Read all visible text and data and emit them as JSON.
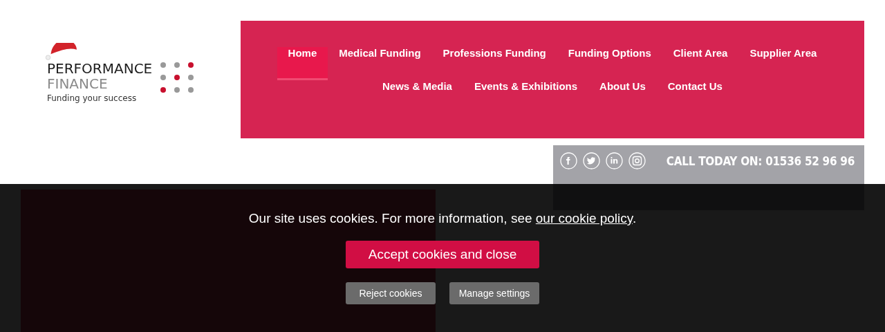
{
  "logo": {
    "line1": "PERFORMANCE",
    "line2": "FINANCE",
    "tagline": "Funding your success"
  },
  "nav": {
    "items": [
      {
        "label": "Home",
        "selected": true
      },
      {
        "label": "Medical Funding",
        "selected": false
      },
      {
        "label": "Professions Funding",
        "selected": false
      },
      {
        "label": "Funding Options",
        "selected": false
      },
      {
        "label": "Client Area",
        "selected": false
      },
      {
        "label": "Supplier Area",
        "selected": false
      },
      {
        "label": "News & Media",
        "selected": false
      },
      {
        "label": "Events & Exhibitions",
        "selected": false
      },
      {
        "label": "About Us",
        "selected": false
      },
      {
        "label": "Contact Us",
        "selected": false
      }
    ]
  },
  "contact": {
    "social": [
      {
        "kind": "facebook"
      },
      {
        "kind": "twitter"
      },
      {
        "kind": "linkedin"
      },
      {
        "kind": "instagram"
      }
    ],
    "call_label": "CALL TODAY ON:",
    "phone": "01536 52 96 96"
  },
  "cookie_banner": {
    "message": "Our site uses cookies. For more information, see ",
    "link": "our cookie policy",
    "message_end": ".",
    "accept": "Accept cookies and close",
    "reject": "Reject cookies",
    "manage": "Manage settings"
  }
}
